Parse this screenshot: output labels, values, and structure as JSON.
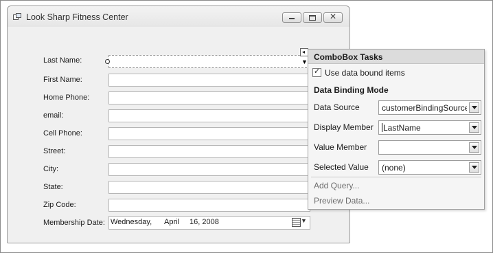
{
  "window": {
    "title": "Look Sharp Fitness Center"
  },
  "form": {
    "labels": {
      "last_name": "Last Name:",
      "first_name": "First Name:",
      "home_phone": "Home Phone:",
      "email": "email:",
      "cell_phone": "Cell Phone:",
      "street": "Street:",
      "city": "City:",
      "state": "State:",
      "zip": "Zip Code:",
      "membership_date": "Membership Date:"
    },
    "date": {
      "weekday": "Wednesday,",
      "month": "April",
      "day_year": "16, 2008"
    }
  },
  "tasks": {
    "title": "ComboBox Tasks",
    "use_data_bound_label": "Use data bound items",
    "use_data_bound_checked": true,
    "section": "Data Binding Mode",
    "data_source_label": "Data Source",
    "data_source_value": "customerBindingSource",
    "display_member_label": "Display Member",
    "display_member_value": "LastName",
    "value_member_label": "Value Member",
    "value_member_value": "",
    "selected_value_label": "Selected Value",
    "selected_value_value": "(none)",
    "add_query": "Add Query...",
    "preview_data": "Preview Data..."
  }
}
